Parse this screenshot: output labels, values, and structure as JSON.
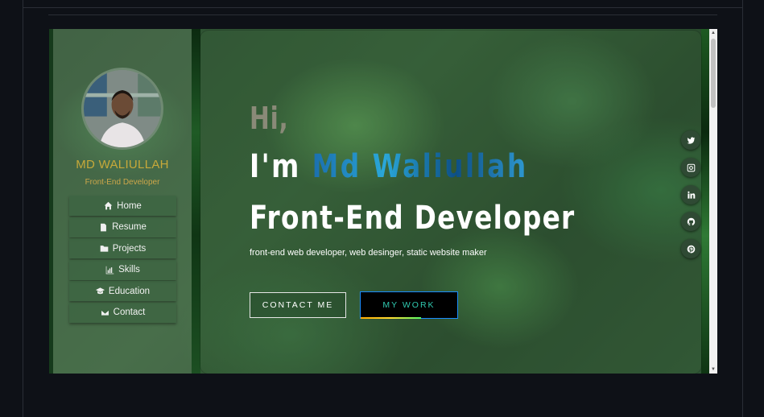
{
  "profile": {
    "name": "MD WALIULLAH",
    "role": "Front-End Developer"
  },
  "nav": {
    "items": [
      {
        "label": "Home",
        "icon": "home-icon"
      },
      {
        "label": "Resume",
        "icon": "file-icon"
      },
      {
        "label": "Projects",
        "icon": "folder-icon"
      },
      {
        "label": "Skills",
        "icon": "bar-chart-icon"
      },
      {
        "label": "Education",
        "icon": "graduation-cap-icon"
      },
      {
        "label": "Contact",
        "icon": "envelope-icon"
      }
    ]
  },
  "hero": {
    "greeting": "Hi,",
    "im_prefix": "I'm ",
    "name_highlight": "Md Waliullah",
    "title": "Front-End Developer",
    "tagline": "front-end web developer, web desinger, static website maker"
  },
  "buttons": {
    "contact": "CONTACT ME",
    "work": "MY WORK"
  },
  "social": [
    {
      "icon": "twitter-icon"
    },
    {
      "icon": "instagram-icon"
    },
    {
      "icon": "linkedin-icon"
    },
    {
      "icon": "github-icon"
    },
    {
      "icon": "pinterest-icon"
    }
  ],
  "colors": {
    "page_bg": "#0e1117",
    "name_color": "#c7a93a",
    "highlight_gradient_start": "#1b6fae",
    "work_button_text": "#30c9b0"
  }
}
